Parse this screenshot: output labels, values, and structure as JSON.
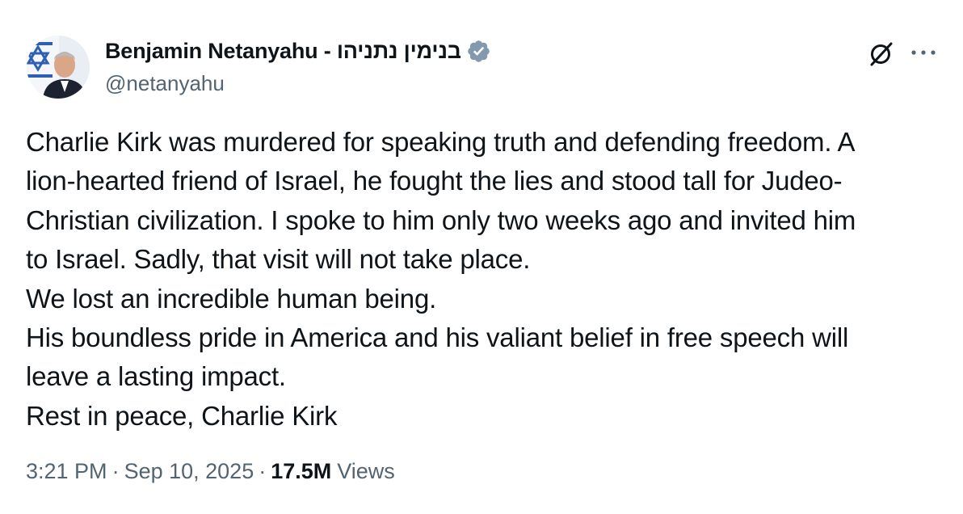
{
  "author": {
    "display_name": "Benjamin Netanyahu - בנימין נתניהו",
    "handle": "@netanyahu",
    "verified": true
  },
  "header_icons": {
    "grok": "grok-icon",
    "more": "more-icon"
  },
  "post": {
    "lines": [
      "Charlie Kirk was murdered for speaking truth and defending freedom. A",
      "lion-hearted friend of Israel, he fought the lies and stood tall for Judeo-",
      "Christian civilization. I spoke to him only two weeks ago and invited him",
      "to Israel. Sadly, that visit will not take place.",
      "We lost an incredible human being.",
      "His boundless pride in America and his valiant belief in free speech will",
      "leave a lasting impact.",
      "Rest in peace, Charlie Kirk"
    ]
  },
  "meta": {
    "time": "3:21 PM",
    "separator": "·",
    "date": "Sep 10, 2025",
    "views_count": "17.5M",
    "views_label": "Views"
  },
  "colors": {
    "text": "#0f1419",
    "secondary": "#536471",
    "verified_badge": "#829aab"
  }
}
